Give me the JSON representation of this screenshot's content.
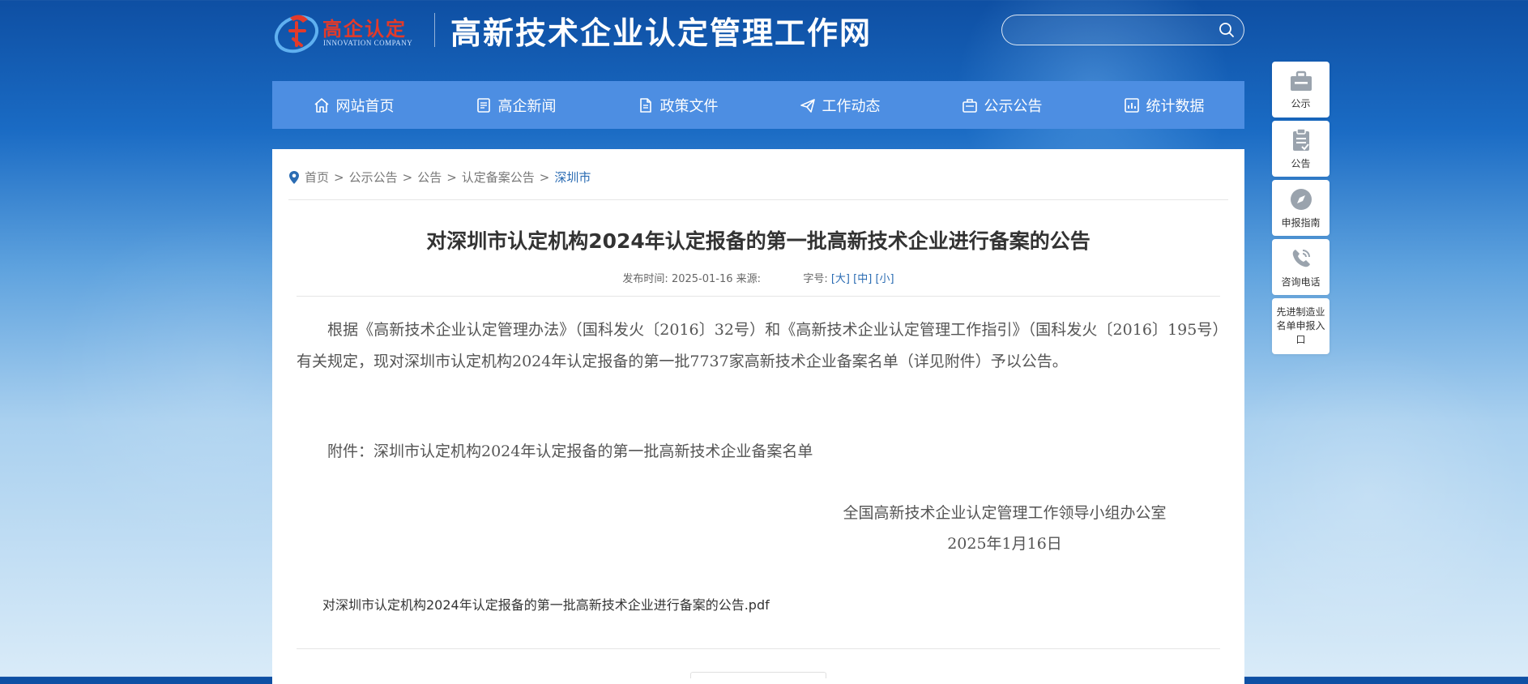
{
  "colors": {
    "nav_bg": "#4d8ee2",
    "link": "#2b6cb3",
    "text": "#555555",
    "title": "#333333",
    "logo_red": "#e23a2a"
  },
  "header": {
    "logo_cn": "高企认定",
    "logo_en": "INNOVATION COMPANY",
    "site_title": "高新技术企业认定管理工作网",
    "search": {
      "value": "",
      "placeholder": "",
      "icon": "search-icon"
    }
  },
  "nav": {
    "items": [
      {
        "label": "网站首页",
        "icon": "home-icon"
      },
      {
        "label": "高企新闻",
        "icon": "news-icon"
      },
      {
        "label": "政策文件",
        "icon": "document-icon"
      },
      {
        "label": "工作动态",
        "icon": "paper-plane-icon"
      },
      {
        "label": "公示公告",
        "icon": "notice-icon"
      },
      {
        "label": "统计数据",
        "icon": "bar-chart-icon"
      }
    ]
  },
  "breadcrumb": {
    "icon": "location-pin-icon",
    "items": [
      "首页",
      "公示公告",
      "公告",
      "认定备案公告",
      "深圳市"
    ],
    "separator": ">"
  },
  "article": {
    "title": "对深圳市认定机构2024年认定报备的第一批高新技术企业进行备案的公告",
    "meta": {
      "publish_label": "发布时间:",
      "publish_date": "2025-01-16",
      "source_label": "来源:",
      "source_value": "",
      "font_label": "字号:",
      "font_large": "[大]",
      "font_medium": "[中]",
      "font_small": "[小]"
    },
    "body": "根据《高新技术企业认定管理办法》（国科发火〔2016〕32号）和《高新技术企业认定管理工作指引》（国科发火〔2016〕195号）有关规定，现对深圳市认定机构2024年认定报备的第一批7737家高新技术企业备案名单（详见附件）予以公告。",
    "attachment": "附件：深圳市认定机构2024年认定报备的第一批高新技术企业备案名单",
    "signature": "全国高新技术企业认定管理工作领导小组办公室",
    "signature_date": "2025年1月16日",
    "pdf_link": "对深圳市认定机构2024年认定报备的第一批高新技术企业进行备案的公告.pdf"
  },
  "side_widgets": [
    {
      "label": "公示",
      "icon": "briefcase-icon"
    },
    {
      "label": "公告",
      "icon": "clipboard-icon"
    },
    {
      "label": "申报指南",
      "icon": "compass-icon"
    },
    {
      "label": "咨询电话",
      "icon": "phone-icon"
    },
    {
      "label": "先进制造业名单申报入口",
      "icon": ""
    }
  ]
}
